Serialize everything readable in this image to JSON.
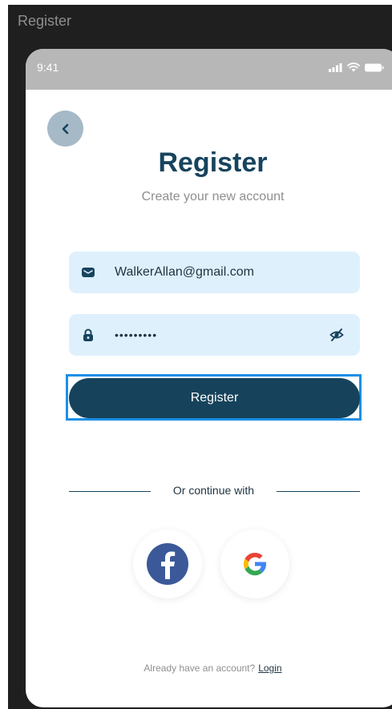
{
  "window": {
    "title": "Register"
  },
  "status_bar": {
    "time": "9:41"
  },
  "header": {
    "title": "Register",
    "subtitle": "Create your new account"
  },
  "form": {
    "email_value": "WalkerAllan@gmail.com",
    "password_value": "•••••••••"
  },
  "actions": {
    "register_label": "Register"
  },
  "social": {
    "divider_text": "Or continue with"
  },
  "footer": {
    "prompt": "Already have an account?",
    "login_label": "Login"
  },
  "icons": {
    "back": "chevron-left-icon",
    "email": "mail-icon",
    "password": "lock-icon",
    "eye": "eye-off-icon",
    "facebook": "facebook-icon",
    "google": "google-icon"
  },
  "colors": {
    "primary": "#17445e",
    "field_bg": "#dff0fd",
    "status_bar": "#b7b7b7",
    "back_button": "#a6b9c6",
    "facebook": "#3b5998"
  }
}
